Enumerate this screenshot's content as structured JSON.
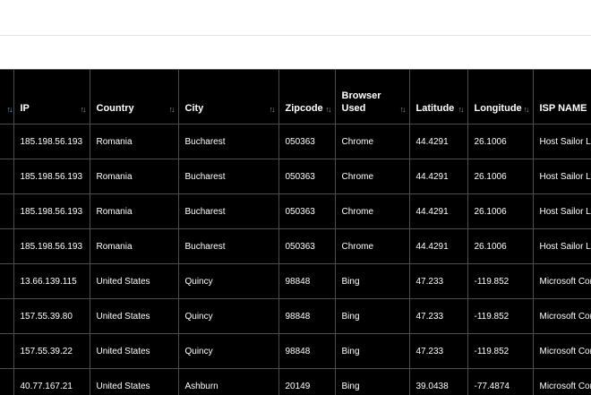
{
  "table": {
    "columns": [
      {
        "key": "stub",
        "label": ""
      },
      {
        "key": "ip",
        "label": "IP"
      },
      {
        "key": "country",
        "label": "Country"
      },
      {
        "key": "city",
        "label": "City"
      },
      {
        "key": "zipcode",
        "label": "Zipcode"
      },
      {
        "key": "browser",
        "label": "Browser Used"
      },
      {
        "key": "latitude",
        "label": "Latitude"
      },
      {
        "key": "longitude",
        "label": "Longitude"
      },
      {
        "key": "isp",
        "label": "ISP NAME"
      }
    ],
    "sort_icon": "↑↓",
    "rows": [
      [
        "",
        "185.198.56.193",
        "Romania",
        "Bucharest",
        "050363",
        "Chrome",
        "44.4291",
        "26.1006",
        "Host Sailor Ltd"
      ],
      [
        "",
        "185.198.56.193",
        "Romania",
        "Bucharest",
        "050363",
        "Chrome",
        "44.4291",
        "26.1006",
        "Host Sailor Ltd"
      ],
      [
        "",
        "185.198.56.193",
        "Romania",
        "Bucharest",
        "050363",
        "Chrome",
        "44.4291",
        "26.1006",
        "Host Sailor Ltd"
      ],
      [
        "",
        "185.198.56.193",
        "Romania",
        "Bucharest",
        "050363",
        "Chrome",
        "44.4291",
        "26.1006",
        "Host Sailor Ltd"
      ],
      [
        "",
        "13.66.139.115",
        "United States",
        "Quincy",
        "98848",
        "Bing",
        "47.233",
        "-119.852",
        "Microsoft Corporation"
      ],
      [
        "",
        "157.55.39.80",
        "United States",
        "Quincy",
        "98848",
        "Bing",
        "47.233",
        "-119.852",
        "Microsoft Corporation"
      ],
      [
        "",
        "157.55.39.22",
        "United States",
        "Quincy",
        "98848",
        "Bing",
        "47.233",
        "-119.852",
        "Microsoft Corporation"
      ],
      [
        "",
        "40.77.167.21",
        "United States",
        "Ashburn",
        "20149",
        "Bing",
        "39.0438",
        "-77.4874",
        "Microsoft Corporation"
      ]
    ]
  },
  "colors": {
    "background": "#000000",
    "grid": "#4d4d4d",
    "text": "#ffffff"
  }
}
